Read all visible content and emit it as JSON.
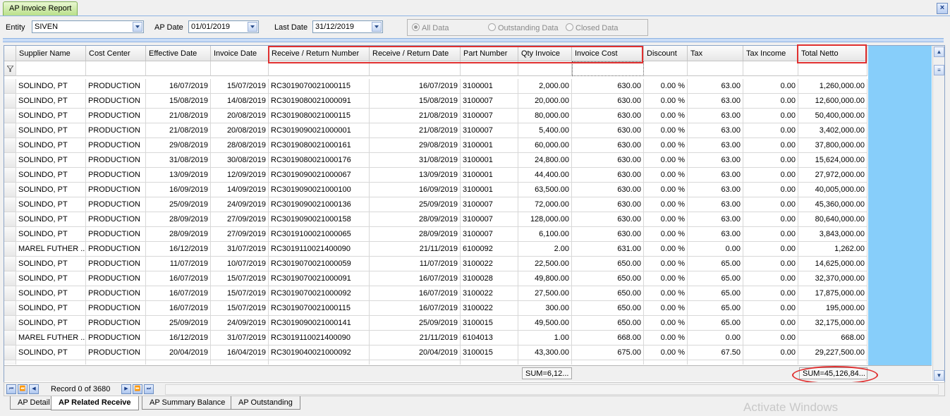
{
  "window": {
    "tab_title": "AP Invoice Report",
    "close_label": "×"
  },
  "filters": {
    "entity_label": "Entity",
    "entity_value": "SIVEN",
    "ap_date_label": "AP Date",
    "ap_date_value": "01/01/2019",
    "last_date_label": "Last Date",
    "last_date_value": "31/12/2019",
    "radio_all": "All Data",
    "radio_outstanding": "Outstanding Data",
    "radio_closed": "Closed Data"
  },
  "grid": {
    "columns": [
      "Supplier Name",
      "Cost Center",
      "Effective Date",
      "Invoice Date",
      "Receive / Return Number",
      "Receive / Return Date",
      "Part Number",
      "Qty Invoice",
      "Invoice Cost",
      "Discount",
      "Tax",
      "Tax Income",
      "Total Netto"
    ],
    "sort_indicator": "△",
    "rows": [
      [
        "SOLINDO, PT",
        "PRODUCTION",
        "16/07/2019",
        "15/07/2019",
        "RC3019070021000115",
        "16/07/2019",
        "3100001",
        "2,000.00",
        "630.00",
        "0.00 %",
        "63.00",
        "0.00",
        "1,260,000.00"
      ],
      [
        "SOLINDO, PT",
        "PRODUCTION",
        "15/08/2019",
        "14/08/2019",
        "RC3019080021000091",
        "15/08/2019",
        "3100007",
        "20,000.00",
        "630.00",
        "0.00 %",
        "63.00",
        "0.00",
        "12,600,000.00"
      ],
      [
        "SOLINDO, PT",
        "PRODUCTION",
        "21/08/2019",
        "20/08/2019",
        "RC3019080021000115",
        "21/08/2019",
        "3100007",
        "80,000.00",
        "630.00",
        "0.00 %",
        "63.00",
        "0.00",
        "50,400,000.00"
      ],
      [
        "SOLINDO, PT",
        "PRODUCTION",
        "21/08/2019",
        "20/08/2019",
        "RC3019090021000001",
        "21/08/2019",
        "3100007",
        "5,400.00",
        "630.00",
        "0.00 %",
        "63.00",
        "0.00",
        "3,402,000.00"
      ],
      [
        "SOLINDO, PT",
        "PRODUCTION",
        "29/08/2019",
        "28/08/2019",
        "RC3019080021000161",
        "29/08/2019",
        "3100001",
        "60,000.00",
        "630.00",
        "0.00 %",
        "63.00",
        "0.00",
        "37,800,000.00"
      ],
      [
        "SOLINDO, PT",
        "PRODUCTION",
        "31/08/2019",
        "30/08/2019",
        "RC3019080021000176",
        "31/08/2019",
        "3100001",
        "24,800.00",
        "630.00",
        "0.00 %",
        "63.00",
        "0.00",
        "15,624,000.00"
      ],
      [
        "SOLINDO, PT",
        "PRODUCTION",
        "13/09/2019",
        "12/09/2019",
        "RC3019090021000067",
        "13/09/2019",
        "3100001",
        "44,400.00",
        "630.00",
        "0.00 %",
        "63.00",
        "0.00",
        "27,972,000.00"
      ],
      [
        "SOLINDO, PT",
        "PRODUCTION",
        "16/09/2019",
        "14/09/2019",
        "RC3019090021000100",
        "16/09/2019",
        "3100001",
        "63,500.00",
        "630.00",
        "0.00 %",
        "63.00",
        "0.00",
        "40,005,000.00"
      ],
      [
        "SOLINDO, PT",
        "PRODUCTION",
        "25/09/2019",
        "24/09/2019",
        "RC3019090021000136",
        "25/09/2019",
        "3100007",
        "72,000.00",
        "630.00",
        "0.00 %",
        "63.00",
        "0.00",
        "45,360,000.00"
      ],
      [
        "SOLINDO, PT",
        "PRODUCTION",
        "28/09/2019",
        "27/09/2019",
        "RC3019090021000158",
        "28/09/2019",
        "3100007",
        "128,000.00",
        "630.00",
        "0.00 %",
        "63.00",
        "0.00",
        "80,640,000.00"
      ],
      [
        "SOLINDO, PT",
        "PRODUCTION",
        "28/09/2019",
        "27/09/2019",
        "RC3019100021000065",
        "28/09/2019",
        "3100007",
        "6,100.00",
        "630.00",
        "0.00 %",
        "63.00",
        "0.00",
        "3,843,000.00"
      ],
      [
        "MAREL FUTHER ...",
        "PRODUCTION",
        "16/12/2019",
        "31/07/2019",
        "RC3019110021400090",
        "21/11/2019",
        "6100092",
        "2.00",
        "631.00",
        "0.00 %",
        "0.00",
        "0.00",
        "1,262.00"
      ],
      [
        "SOLINDO, PT",
        "PRODUCTION",
        "11/07/2019",
        "10/07/2019",
        "RC3019070021000059",
        "11/07/2019",
        "3100022",
        "22,500.00",
        "650.00",
        "0.00 %",
        "65.00",
        "0.00",
        "14,625,000.00"
      ],
      [
        "SOLINDO, PT",
        "PRODUCTION",
        "16/07/2019",
        "15/07/2019",
        "RC3019070021000091",
        "16/07/2019",
        "3100028",
        "49,800.00",
        "650.00",
        "0.00 %",
        "65.00",
        "0.00",
        "32,370,000.00"
      ],
      [
        "SOLINDO, PT",
        "PRODUCTION",
        "16/07/2019",
        "15/07/2019",
        "RC3019070021000092",
        "16/07/2019",
        "3100022",
        "27,500.00",
        "650.00",
        "0.00 %",
        "65.00",
        "0.00",
        "17,875,000.00"
      ],
      [
        "SOLINDO, PT",
        "PRODUCTION",
        "16/07/2019",
        "15/07/2019",
        "RC3019070021000115",
        "16/07/2019",
        "3100022",
        "300.00",
        "650.00",
        "0.00 %",
        "65.00",
        "0.00",
        "195,000.00"
      ],
      [
        "SOLINDO, PT",
        "PRODUCTION",
        "25/09/2019",
        "24/09/2019",
        "RC3019090021000141",
        "25/09/2019",
        "3100015",
        "49,500.00",
        "650.00",
        "0.00 %",
        "65.00",
        "0.00",
        "32,175,000.00"
      ],
      [
        "MAREL FUTHER ...",
        "PRODUCTION",
        "16/12/2019",
        "31/07/2019",
        "RC3019110021400090",
        "21/11/2019",
        "6104013",
        "1.00",
        "668.00",
        "0.00 %",
        "0.00",
        "0.00",
        "668.00"
      ],
      [
        "SOLINDO, PT",
        "PRODUCTION",
        "20/04/2019",
        "16/04/2019",
        "RC3019040021000092",
        "20/04/2019",
        "3100015",
        "43,300.00",
        "675.00",
        "0.00 %",
        "67.50",
        "0.00",
        "29,227,500.00"
      ]
    ],
    "sum_qty": "SUM=6,12...",
    "sum_total": "SUM=45,126,84..."
  },
  "navigator": {
    "record_text": "Record 0 of 3680"
  },
  "bottom_tabs": [
    "AP Detail",
    "AP Related Receive",
    "AP Summary Balance",
    "AP Outstanding"
  ],
  "watermark": "Activate Windows"
}
